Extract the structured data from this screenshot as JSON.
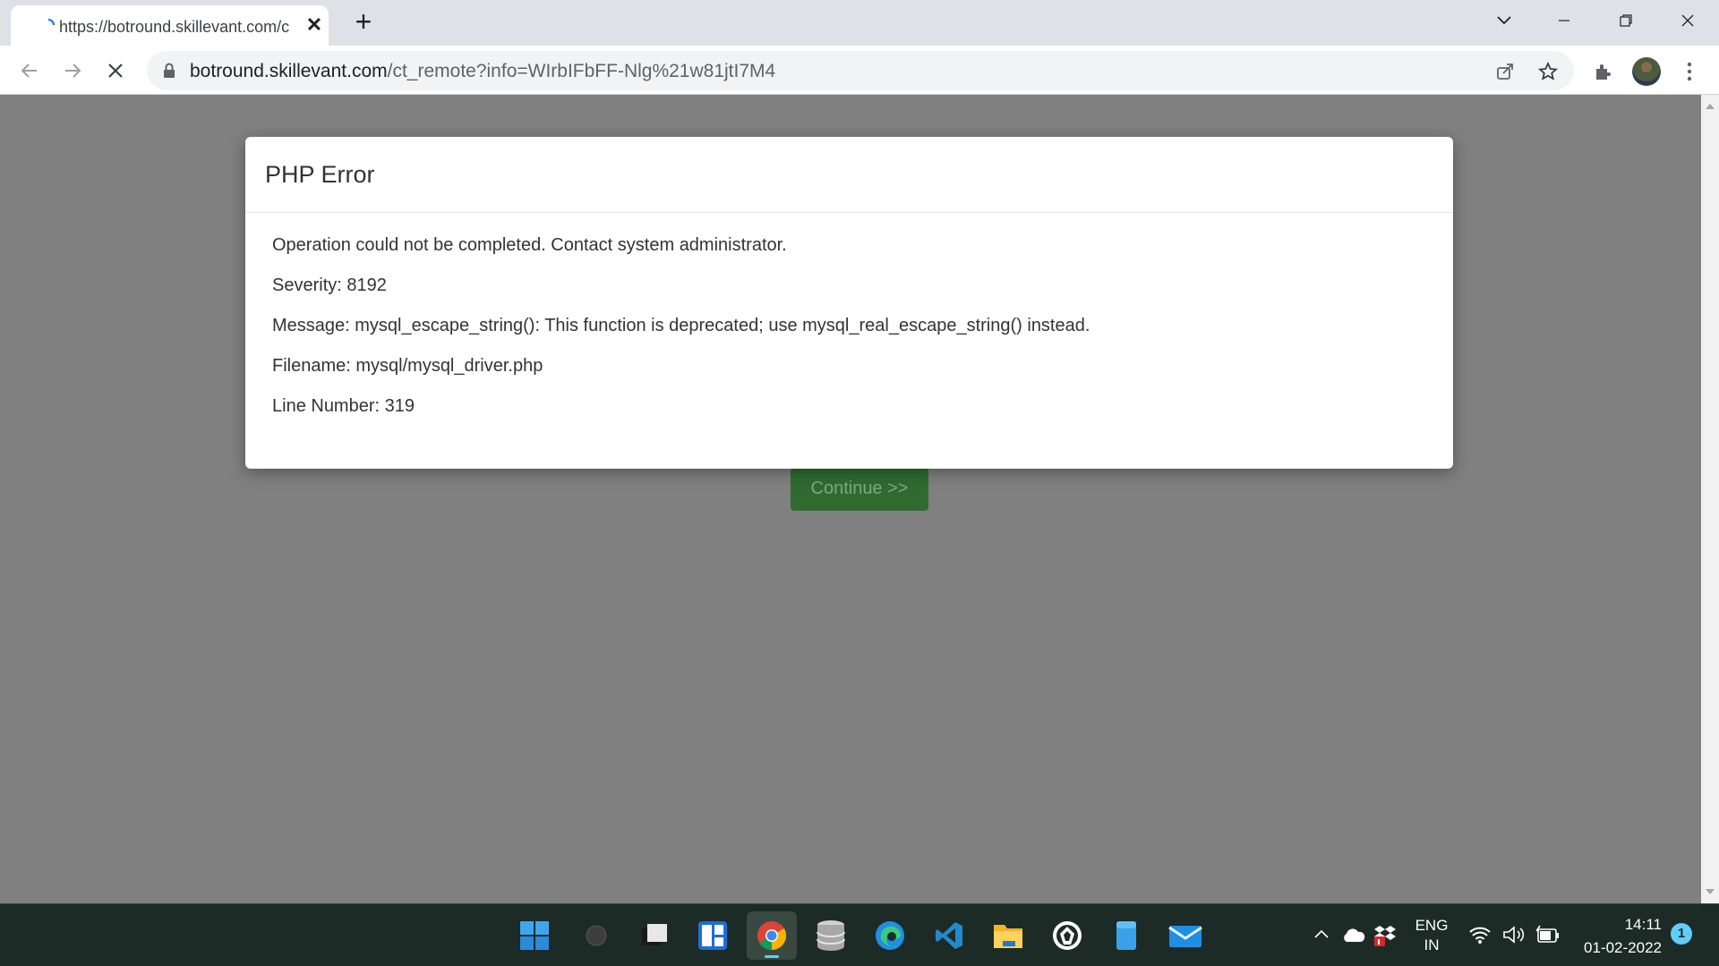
{
  "browser": {
    "tab_title": "https://botround.skillevant.com/c",
    "url_domain": "botround.skillevant.com",
    "url_path": "/ct_remote?info=WIrbIFbFF-Nlg%21w81jtI7M4"
  },
  "page": {
    "continue_label": "Continue >>",
    "modal": {
      "title": "PHP Error",
      "lines": [
        "Operation could not be completed. Contact system administrator.",
        "Severity: 8192",
        "Message: mysql_escape_string(): This function is deprecated; use mysql_real_escape_string() instead.",
        "Filename: mysql/mysql_driver.php",
        "Line Number: 319"
      ]
    }
  },
  "taskbar": {
    "lang_top": "ENG",
    "lang_bottom": "IN",
    "time": "14:11",
    "date": "01-02-2022",
    "notification_count": "1",
    "apps": [
      "start-icon",
      "search-icon",
      "task-view-icon",
      "widgets-icon",
      "chrome-icon",
      "database-icon",
      "edge-icon",
      "vscode-icon",
      "file-explorer-icon",
      "app-icon",
      "notepad-icon",
      "mail-icon"
    ]
  },
  "colors": {
    "continue_button": "#2f6b30",
    "overlay": "#808080",
    "taskbar": "#1d2b26",
    "accent": "#60cdff"
  }
}
